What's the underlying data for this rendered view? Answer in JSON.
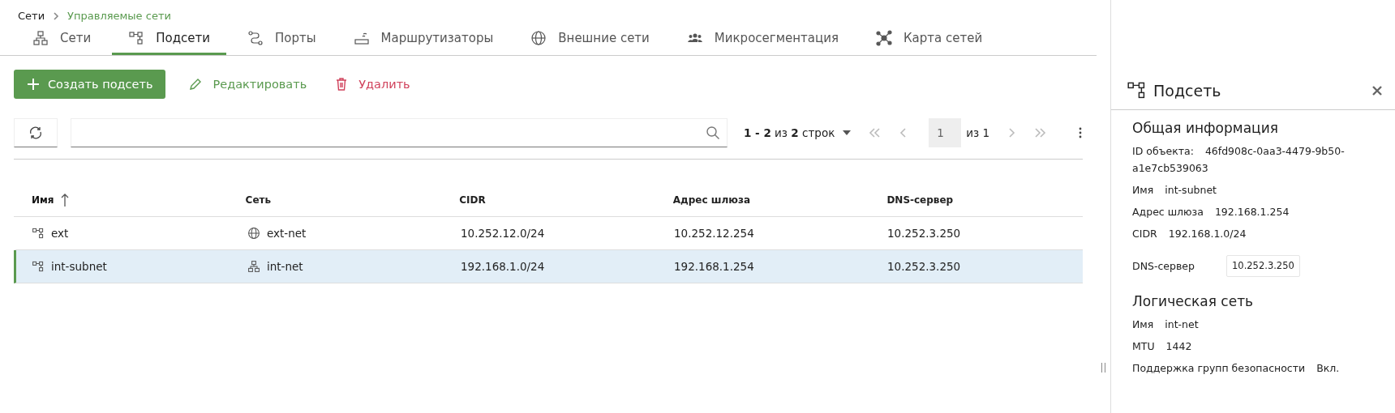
{
  "breadcrumb": [
    {
      "label": "Сети",
      "current": false
    },
    {
      "label": "Управляемые сети",
      "current": true
    }
  ],
  "tabs": [
    {
      "label": "Сети",
      "kind": "network",
      "selected": false
    },
    {
      "label": "Подсети",
      "kind": "subnet",
      "selected": true
    },
    {
      "label": "Порты",
      "kind": "port",
      "selected": false
    },
    {
      "label": "Маршрутизаторы",
      "kind": "router",
      "selected": false
    },
    {
      "label": "Внешние сети",
      "kind": "globe",
      "selected": false
    },
    {
      "label": "Микросегментация",
      "kind": "users",
      "selected": false
    },
    {
      "label": "Карта сетей",
      "kind": "map",
      "selected": false
    }
  ],
  "toolbar": {
    "create": "Создать подсеть",
    "edit": "Редактировать",
    "delete": "Удалить"
  },
  "pagination": {
    "range": "1 - 2",
    "of_word": "из",
    "total": "2",
    "rows_word": "строк",
    "page": "1",
    "pages_word": "из 1"
  },
  "table": {
    "columns": [
      {
        "label": "Имя",
        "sorted": true
      },
      {
        "label": "Сеть",
        "sorted": false
      },
      {
        "label": "CIDR",
        "sorted": false
      },
      {
        "label": "Адрес шлюза",
        "sorted": false
      },
      {
        "label": "DNS-сервер",
        "sorted": false
      }
    ],
    "rows": [
      {
        "name": "ext",
        "network": "ext-net",
        "kind": "external",
        "cidr": "10.252.12.0/24",
        "gateway": "10.252.12.254",
        "dns": "10.252.3.250",
        "selected": false
      },
      {
        "name": "int-subnet",
        "network": "int-net",
        "kind": "internal",
        "cidr": "192.168.1.0/24",
        "gateway": "192.168.1.254",
        "dns": "10.252.3.250",
        "selected": true
      }
    ]
  },
  "panel": {
    "title": "Подсеть",
    "sections": [
      {
        "title": "Общая информация",
        "fields": [
          {
            "label": "ID объекта:",
            "value": "46fd908c-0aa3-4479-9b50-a1e7cb539063",
            "kind": "text"
          },
          {
            "label": "Имя",
            "value": "int-subnet",
            "kind": "text"
          },
          {
            "label": "Адрес шлюза",
            "value": "192.168.1.254",
            "kind": "text"
          },
          {
            "label": "CIDR",
            "value": "192.168.1.0/24",
            "kind": "text"
          },
          {
            "label": "DNS-сервер",
            "value": "10.252.3.250",
            "kind": "box"
          }
        ]
      },
      {
        "title": "Логическая сеть",
        "fields": [
          {
            "label": "Имя",
            "value": "int-net",
            "kind": "text"
          },
          {
            "label": "MTU",
            "value": "1442",
            "kind": "text"
          },
          {
            "label": "Поддержка групп безопасности",
            "value": "Вкл.",
            "kind": "text"
          }
        ]
      }
    ]
  }
}
